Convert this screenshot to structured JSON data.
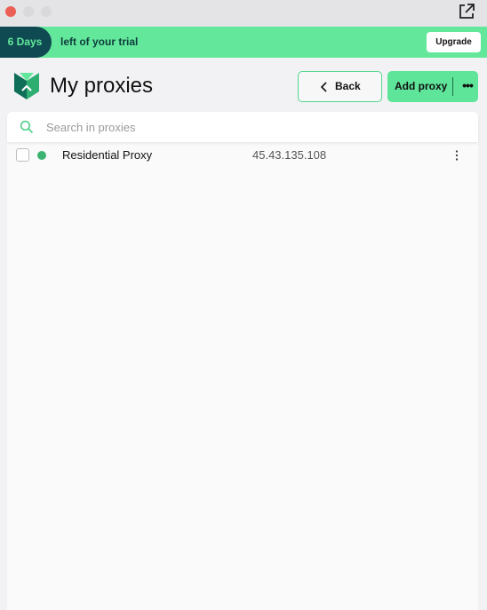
{
  "trial": {
    "days_label": "6 Days",
    "message": "left of your trial",
    "upgrade_label": "Upgrade"
  },
  "header": {
    "title": "My proxies",
    "back_label": "Back",
    "add_proxy_label": "Add proxy",
    "more_label": "•••"
  },
  "search": {
    "placeholder": "Search in proxies"
  },
  "proxies": [
    {
      "name": "Residential Proxy",
      "ip": "45.43.135.108",
      "status": "online"
    }
  ],
  "colors": {
    "accent": "#63e89b",
    "dark_accent": "#0f4a52",
    "status_online": "#3cb371"
  },
  "icons": {
    "window_action": "external-link-icon",
    "logo": "app-logo",
    "back": "chevron-left-icon",
    "search": "search-icon",
    "row_menu": "kebab-menu-icon"
  }
}
